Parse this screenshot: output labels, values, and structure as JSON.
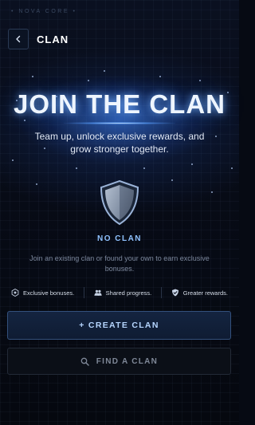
{
  "app": {
    "brand": "• NOVA CORE •"
  },
  "header": {
    "title": "CLAN",
    "back_icon": "chevron-left-icon"
  },
  "hero": {
    "title": "JOIN THE CLAN",
    "subtitle": "Team up, unlock exclusive rewards, and grow stronger together."
  },
  "status": {
    "icon": "shield-icon",
    "label": "NO CLAN",
    "description": "Join an existing clan or found your own to earn exclusive bonuses."
  },
  "features": [
    {
      "icon": "star-badge-icon",
      "label": "Exclusive bonuses."
    },
    {
      "icon": "users-icon",
      "label": "Shared progress."
    },
    {
      "icon": "shield-check-icon",
      "label": "Greater rewards."
    }
  ],
  "actions": {
    "create_label": "+ CREATE CLAN",
    "find_label": "FIND A CLAN",
    "find_icon": "search-icon"
  },
  "colors": {
    "accent": "#8fc2ff",
    "background": "#060a13",
    "primary_button_text": "#b6d6ff"
  }
}
